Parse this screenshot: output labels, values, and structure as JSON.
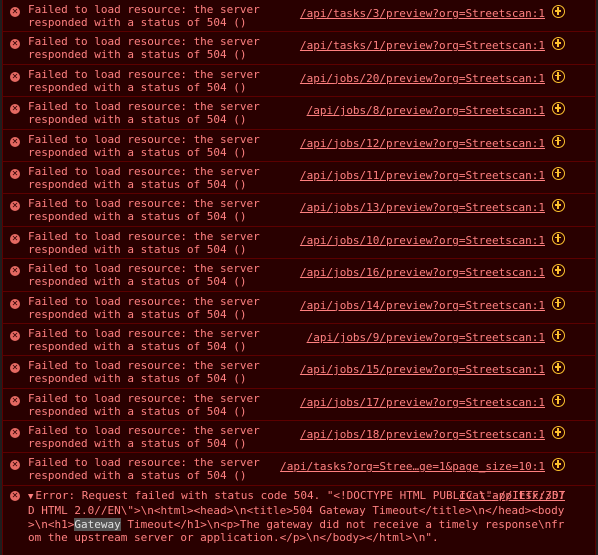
{
  "messages": [
    {
      "text": "Failed to load resource: the server\nresponded with a status of 504 ()",
      "url": "/api/tasks/3/preview?org=Streetscan:1"
    },
    {
      "text": "Failed to load resource: the server\nresponded with a status of 504 ()",
      "url": "/api/tasks/1/preview?org=Streetscan:1"
    },
    {
      "text": "Failed to load resource: the server\nresponded with a status of 504 ()",
      "url": "/api/jobs/20/preview?org=Streetscan:1"
    },
    {
      "text": "Failed to load resource: the server\nresponded with a status of 504 ()",
      "url": "/api/jobs/8/preview?org=Streetscan:1"
    },
    {
      "text": "Failed to load resource: the server\nresponded with a status of 504 ()",
      "url": "/api/jobs/12/preview?org=Streetscan:1"
    },
    {
      "text": "Failed to load resource: the server\nresponded with a status of 504 ()",
      "url": "/api/jobs/11/preview?org=Streetscan:1"
    },
    {
      "text": "Failed to load resource: the server\nresponded with a status of 504 ()",
      "url": "/api/jobs/13/preview?org=Streetscan:1"
    },
    {
      "text": "Failed to load resource: the server\nresponded with a status of 504 ()",
      "url": "/api/jobs/10/preview?org=Streetscan:1"
    },
    {
      "text": "Failed to load resource: the server\nresponded with a status of 504 ()",
      "url": "/api/jobs/16/preview?org=Streetscan:1"
    },
    {
      "text": "Failed to load resource: the server\nresponded with a status of 504 ()",
      "url": "/api/jobs/14/preview?org=Streetscan:1"
    },
    {
      "text": "Failed to load resource: the server\nresponded with a status of 504 ()",
      "url": "/api/jobs/9/preview?org=Streetscan:1"
    },
    {
      "text": "Failed to load resource: the server\nresponded with a status of 504 ()",
      "url": "/api/jobs/15/preview?org=Streetscan:1"
    },
    {
      "text": "Failed to load resource: the server\nresponded with a status of 504 ()",
      "url": "/api/jobs/17/preview?org=Streetscan:1"
    },
    {
      "text": "Failed to load resource: the server\nresponded with a status of 504 ()",
      "url": "/api/jobs/18/preview?org=Streetscan:1"
    },
    {
      "text": "Failed to load resource: the server\nresponded with a status of 504 ()",
      "url": "/api/tasks?org=Stree…ge=1&page_size=10:1"
    }
  ],
  "final_error": {
    "text_before": "Error: Request failed with status code 504. \"<!DOCTYPE HTML PUBLIC \\\"-//IETF//DTD HTML 2.0//EN\\\">\\n<html><head>\\n<title>504 Gateway Timeout</title>\\n</head><body>\\n<h1>",
    "highlight": "Gateway",
    "text_after": " Timeout</h1>\\n<p>The gateway did not receive a timely response\\nfrom the upstream server or application.</p>\\n</body></html>\\n\".",
    "source": "cvat-app.tsx:357"
  },
  "icons": {
    "error": "error-circle-x-icon",
    "network": "network-request-icon",
    "expand": "expand-triangle-icon"
  },
  "colors": {
    "background": "#290000",
    "text": "#ff8080",
    "error_icon": "#e46962",
    "network_icon": "#fbc02d",
    "border": "#5c0000"
  }
}
